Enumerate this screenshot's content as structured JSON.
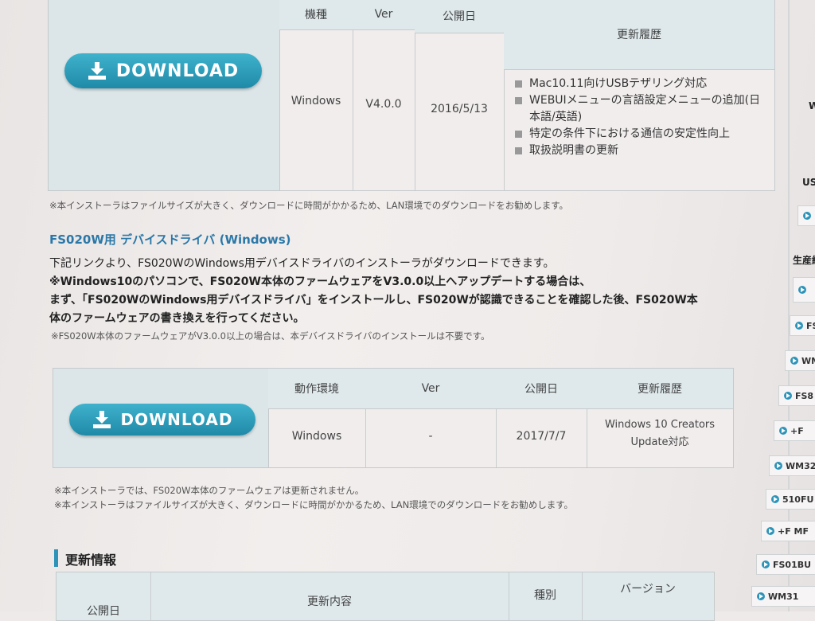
{
  "download1": {
    "button_label": "DOWNLOAD",
    "headers": [
      "機種",
      "Ver",
      "公開日",
      "更新履歴"
    ],
    "row": {
      "model": "Windows",
      "ver": "V4.0.0",
      "date": "2016/5/13"
    },
    "history": [
      "Mac10.11向けUSBテザリング対応",
      "WEBUIメニューの言語設定メニューの追加(日本語/英語)",
      "特定の条件下における通信の安定性向上",
      "取扱説明書の更新"
    ],
    "note": "※本インストーラはファイルサイズが大きく、ダウンロードに時間がかかるため、LAN環境でのダウンロードをお勧めします。"
  },
  "driver_section": {
    "title": "FS020W用 デバイスドライバ (Windows)",
    "intro": "下記リンクより、FS020WのWindows用デバイスドライバのインストーラがダウンロードできます。",
    "bold_lines": [
      "※Windows10のパソコンで、FS020W本体のファームウェアをV3.0.0以上へアップデートする場合は、",
      "まず、「FS020WのWindows用デバイスドライバ」をインストールし、FS020Wが認識できることを確認した後、FS020W本",
      "体のファームウェアの書き換えを行ってください。"
    ],
    "small_note": "※FS020W本体のファームウェアがV3.0.0以上の場合は、本デバイスドライバのインストールは不要です。"
  },
  "download2": {
    "button_label": "DOWNLOAD",
    "headers": [
      "動作環境",
      "Ver",
      "公開日",
      "更新履歴"
    ],
    "row": {
      "env": "Windows",
      "ver": "-",
      "date": "2017/7/7",
      "history_l1": "Windows 10 Creators",
      "history_l2": "Update対応"
    },
    "notes": [
      "※本インストーラでは、FS020W本体のファームウェアは更新されません。",
      "※本インストーラはファイルサイズが大きく、ダウンロードに時間がかかるため、LAN環境でのダウンロードをお勧めします。"
    ]
  },
  "update_info": {
    "title": "更新情報",
    "headers": [
      "公開日",
      "更新内容",
      "種別",
      "バージョン"
    ]
  },
  "sidebar": {
    "texts": [
      "W",
      "USB",
      "生産終"
    ],
    "items": [
      "",
      "FS",
      "WM",
      "FS8",
      "+F",
      "WM32",
      "510FU",
      "+F MF",
      "FS01BU",
      "WM31"
    ]
  },
  "colors": {
    "accent": "#2d93b8",
    "header_bg": "#dfe9ec",
    "button": "#2a9dbb"
  }
}
